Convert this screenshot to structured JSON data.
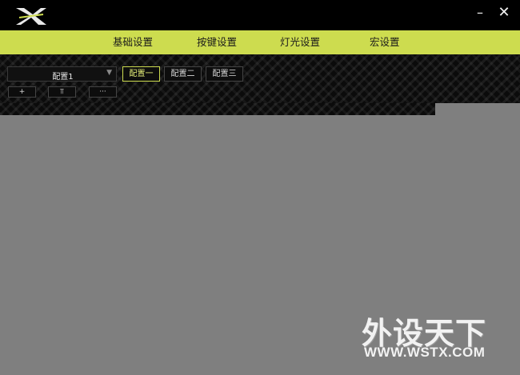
{
  "window": {
    "logo_icon": "x-logo-icon",
    "minimize_label": "–",
    "close_label": "✕"
  },
  "nav": {
    "items": [
      {
        "label": "基础设置"
      },
      {
        "label": "按键设置"
      },
      {
        "label": "灯光设置"
      },
      {
        "label": "宏设置"
      }
    ]
  },
  "toolbar": {
    "profile_select": {
      "value": "配置1",
      "caret": "▼"
    },
    "configs": [
      {
        "label": "配置一",
        "active": true
      },
      {
        "label": "配置二",
        "active": false
      },
      {
        "label": "配置三",
        "active": false
      }
    ],
    "actions": [
      {
        "label": "+"
      },
      {
        "label": "⫪"
      },
      {
        "label": "···"
      }
    ]
  },
  "watermark": {
    "title": "外设天下",
    "url": "WWW.WSTX.COM"
  },
  "colors": {
    "accent": "#cddc4f",
    "titlebar": "#000000",
    "content_bg": "#7f7f7f"
  }
}
